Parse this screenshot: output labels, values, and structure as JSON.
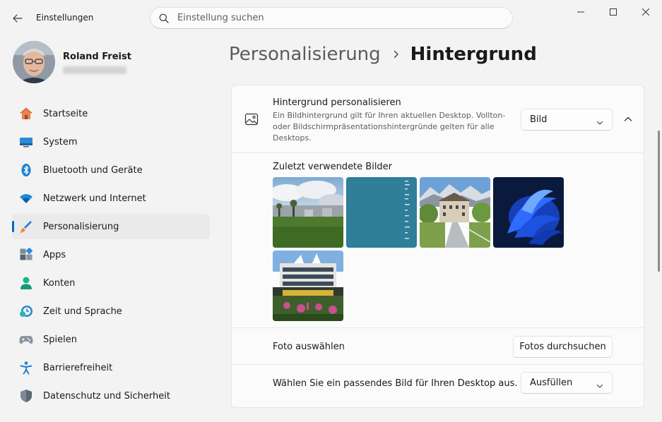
{
  "window": {
    "title": "Einstellungen"
  },
  "search": {
    "placeholder": "Einstellung suchen"
  },
  "profile": {
    "name": "Roland Freist"
  },
  "nav": {
    "items": [
      {
        "label": "Startseite",
        "icon": "home-icon"
      },
      {
        "label": "System",
        "icon": "display-icon"
      },
      {
        "label": "Bluetooth und Geräte",
        "icon": "bluetooth-icon"
      },
      {
        "label": "Netzwerk und Internet",
        "icon": "wifi-icon"
      },
      {
        "label": "Personalisierung",
        "icon": "paintbrush-icon",
        "active": true
      },
      {
        "label": "Apps",
        "icon": "apps-icon"
      },
      {
        "label": "Konten",
        "icon": "person-icon"
      },
      {
        "label": "Zeit und Sprache",
        "icon": "clock-globe-icon"
      },
      {
        "label": "Spielen",
        "icon": "gamepad-icon"
      },
      {
        "label": "Barrierefreiheit",
        "icon": "accessibility-icon"
      },
      {
        "label": "Datenschutz und Sicherheit",
        "icon": "shield-icon"
      }
    ]
  },
  "breadcrumb": {
    "parent": "Personalisierung",
    "current": "Hintergrund"
  },
  "background": {
    "title": "Hintergrund personalisieren",
    "description": "Ein Bildhintergrund gilt für Ihren aktuellen Desktop. Vollton- oder Bildschirmpräsentationshintergründe gelten für alle Desktops.",
    "type_value": "Bild",
    "recent_label": "Zuletzt verwendete Bilder",
    "photo_label": "Foto auswählen",
    "browse_button": "Fotos durchsuchen",
    "fit_label": "Wählen Sie ein passendes Bild für Ihren Desktop aus.",
    "fit_value": "Ausfüllen"
  },
  "colors": {
    "accent": "#0067c0",
    "window_bg": "#f3f3f3",
    "card_bg": "#fbfbfb"
  }
}
